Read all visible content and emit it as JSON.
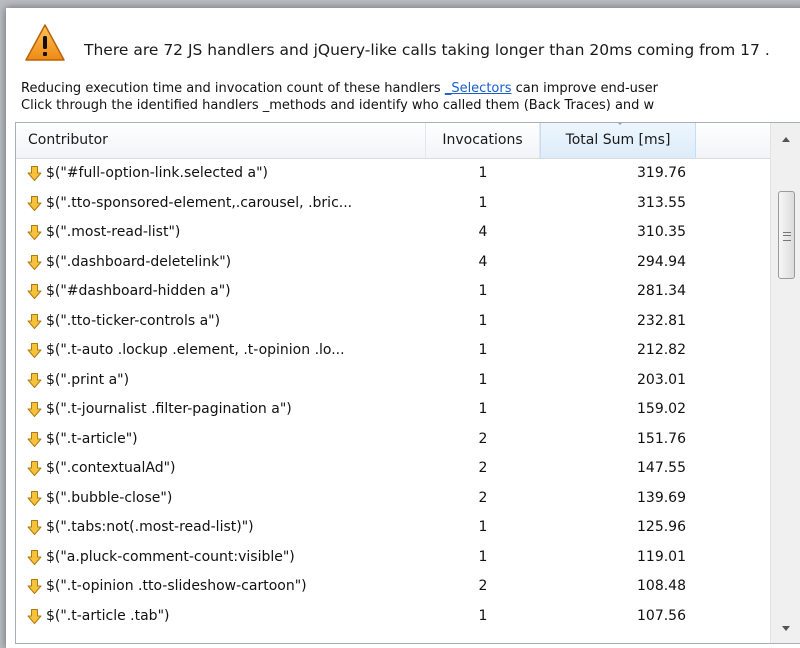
{
  "warning": {
    "title": "There are 72 JS handlers and jQuery-like calls taking longer than 20ms coming from 17 ."
  },
  "description": {
    "line1_before": "Reducing execution time and invocation count of these handlers ",
    "line1_link": "_Selectors",
    "line1_after": " can improve end-user",
    "line2": "Click through the identified handlers _methods and identify who called them (Back Traces) and w"
  },
  "table": {
    "columns": {
      "contributor": "Contributor",
      "invocations": "Invocations",
      "total_sum": "Total Sum [ms]"
    },
    "sorted_column": "total_sum",
    "rows": [
      {
        "contributor": "$(\"#full-option-link.selected a\")",
        "invocations": "1",
        "total": "319.76"
      },
      {
        "contributor": "$(\".tto-sponsored-element,.carousel, .bric...",
        "invocations": "1",
        "total": "313.55"
      },
      {
        "contributor": "$(\".most-read-list\")",
        "invocations": "4",
        "total": "310.35"
      },
      {
        "contributor": "$(\".dashboard-deletelink\")",
        "invocations": "4",
        "total": "294.94"
      },
      {
        "contributor": "$(\"#dashboard-hidden a\")",
        "invocations": "1",
        "total": "281.34"
      },
      {
        "contributor": "$(\".tto-ticker-controls a\")",
        "invocations": "1",
        "total": "232.81"
      },
      {
        "contributor": "$(\".t-auto .lockup .element, .t-opinion .lo...",
        "invocations": "1",
        "total": "212.82"
      },
      {
        "contributor": "$(\".print a\")",
        "invocations": "1",
        "total": "203.01"
      },
      {
        "contributor": "$(\".t-journalist .filter-pagination a\")",
        "invocations": "1",
        "total": "159.02"
      },
      {
        "contributor": "$(\".t-article\")",
        "invocations": "2",
        "total": "151.76"
      },
      {
        "contributor": "$(\".contextualAd\")",
        "invocations": "2",
        "total": "147.55"
      },
      {
        "contributor": "$(\".bubble-close\")",
        "invocations": "2",
        "total": "139.69"
      },
      {
        "contributor": "$(\".tabs:not(.most-read-list)\")",
        "invocations": "1",
        "total": "125.96"
      },
      {
        "contributor": "$(\"a.pluck-comment-count:visible\")",
        "invocations": "1",
        "total": "119.01"
      },
      {
        "contributor": "$(\".t-opinion .tto-slideshow-cartoon\")",
        "invocations": "2",
        "total": "108.48"
      },
      {
        "contributor": "$(\".t-article .tab\")",
        "invocations": "1",
        "total": "107.56"
      }
    ]
  },
  "icons": {
    "warning": "warning-triangle-icon",
    "row": "down-arrow-icon"
  },
  "colors": {
    "warning_fill": "#f39a1f",
    "row_icon_fill": "#f5c23a",
    "link": "#1a5fc9",
    "sorted_header": "#dcecfa"
  }
}
